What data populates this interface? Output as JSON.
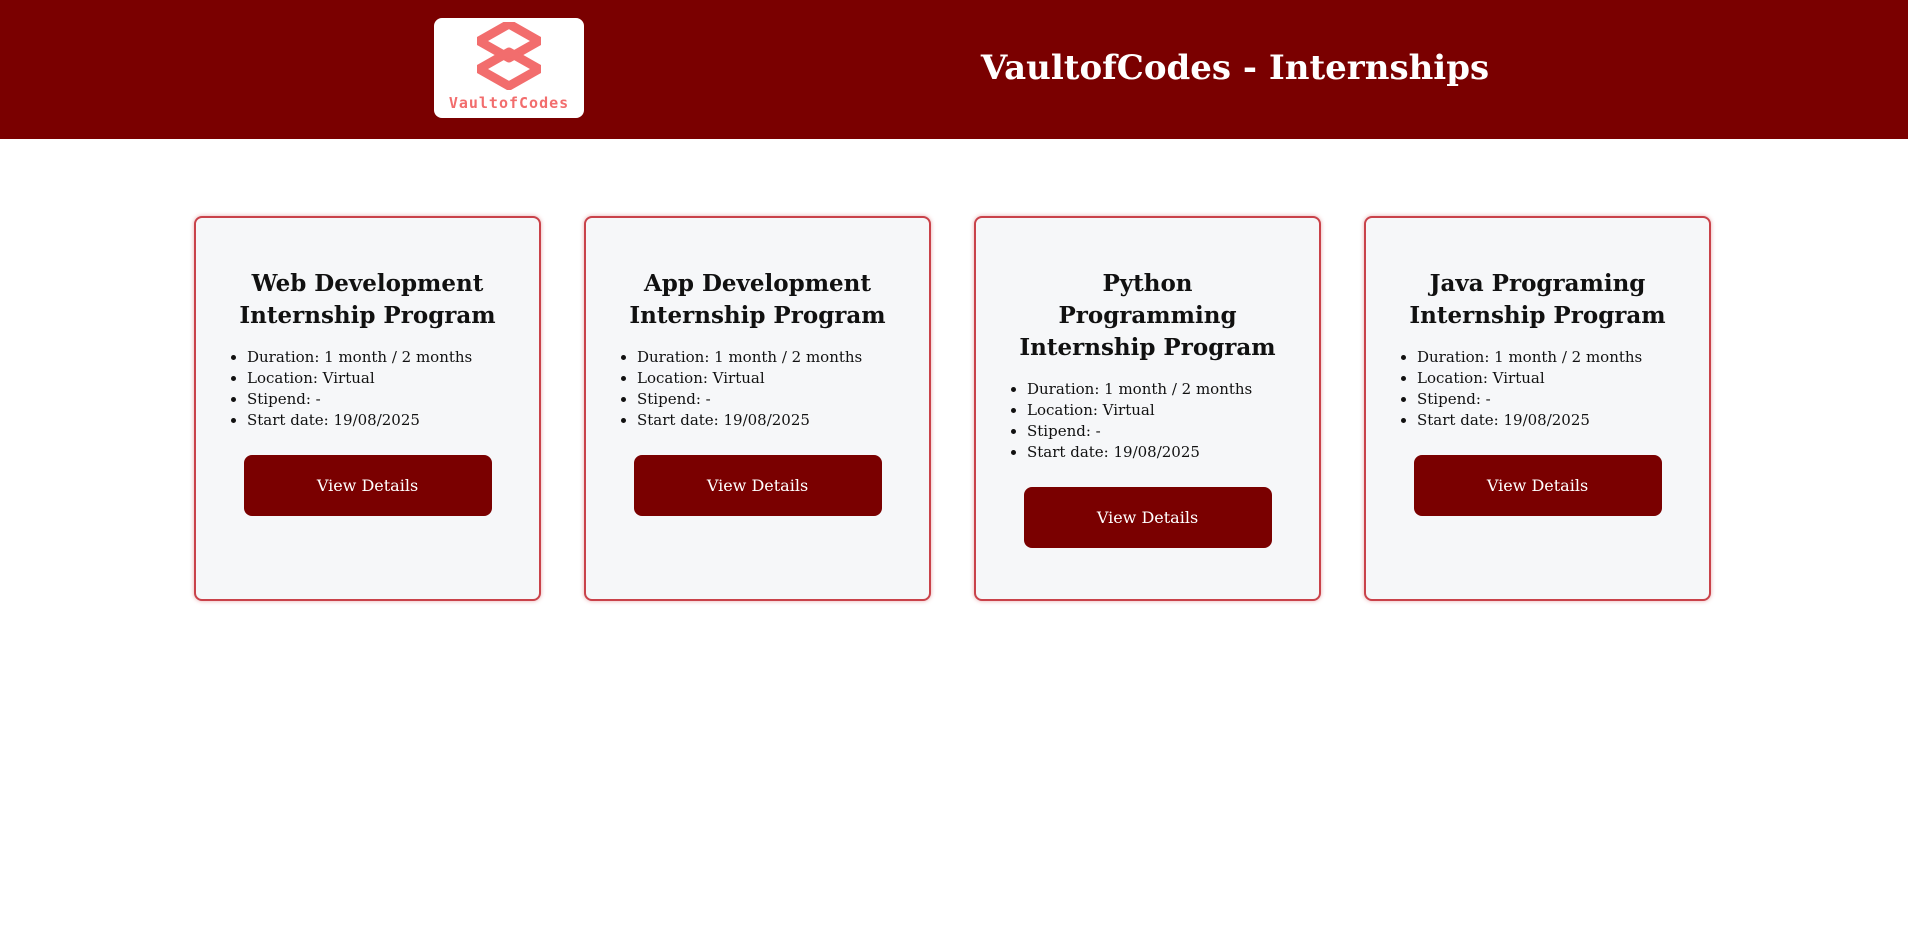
{
  "header": {
    "logo_text": "VaultofCodes",
    "title": "VaultofCodes - Internships",
    "logo_color": "#f26d6d",
    "background_color": "#7a0000"
  },
  "cards": [
    {
      "title": "Web Development Internship Program",
      "details": [
        "Duration: 1 month / 2 months",
        "Location: Virtual",
        "Stipend: -",
        "Start date: 19/08/2025"
      ],
      "button_label": "View Details"
    },
    {
      "title": "App Development Internship Program",
      "details": [
        "Duration: 1 month / 2 months",
        "Location: Virtual",
        "Stipend: -",
        "Start date: 19/08/2025"
      ],
      "button_label": "View Details"
    },
    {
      "title": "Python Programming Internship Program",
      "details": [
        "Duration: 1 month / 2 months",
        "Location: Virtual",
        "Stipend: -",
        "Start date: 19/08/2025"
      ],
      "button_label": "View Details"
    },
    {
      "title": "Java Programing Internship Program",
      "details": [
        "Duration: 1 month / 2 months",
        "Location: Virtual",
        "Stipend: -",
        "Start date: 19/08/2025"
      ],
      "button_label": "View Details"
    }
  ]
}
